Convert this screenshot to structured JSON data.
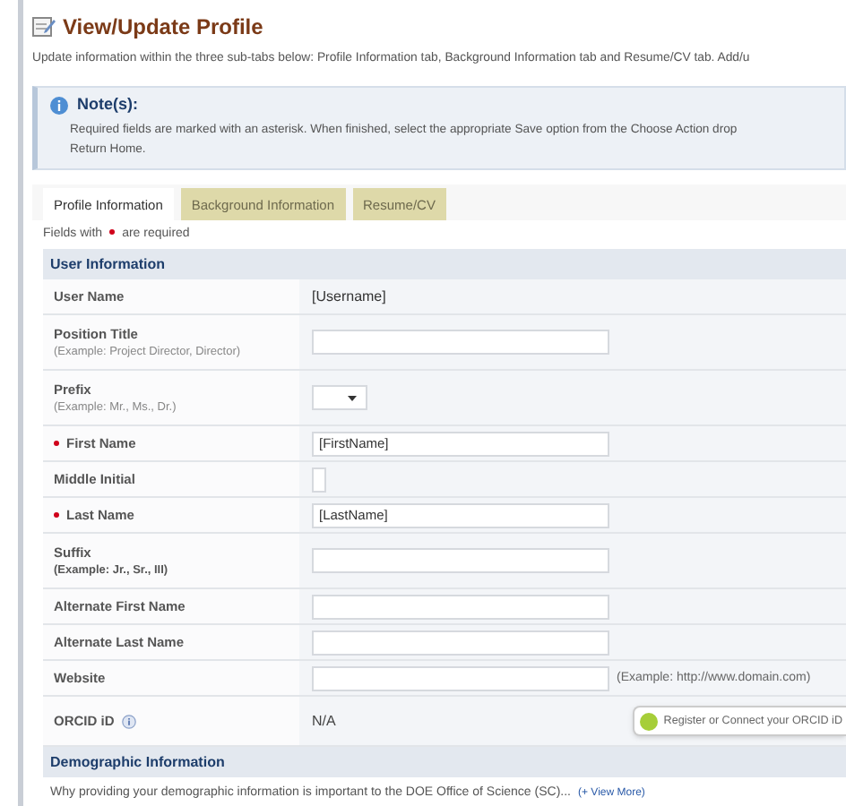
{
  "header": {
    "title": "View/Update Profile",
    "description": "Update information within the three sub-tabs below: Profile Information tab, Background Information tab and Resume/CV tab. Add/u"
  },
  "note": {
    "title": "Note(s):",
    "text": "Required fields are marked with an asterisk. When finished, select the appropriate Save option from the Choose Action drop",
    "text_2": "Return Home."
  },
  "tabs": [
    {
      "label": "Profile Information",
      "selected": true
    },
    {
      "label": "Background Information",
      "selected": false
    },
    {
      "label": "Resume/CV",
      "selected": false
    }
  ],
  "required_hint": {
    "before": "Fields with",
    "after": "are required"
  },
  "user_information": {
    "title": "User Information",
    "rows": [
      {
        "kind": "text",
        "label": "User Name",
        "required": false,
        "value": "[Username]"
      },
      {
        "kind": "input",
        "label": "Position Title",
        "hint": "(Example: Project Director, Director)",
        "required": false
      },
      {
        "kind": "select",
        "label": "Prefix",
        "hint": "(Example: Mr., Ms., Dr.)",
        "required": false
      },
      {
        "kind": "input",
        "label": "First Name",
        "required": true,
        "value": "[FirstName]"
      },
      {
        "kind": "initial",
        "label": "Middle Initial",
        "required": false
      },
      {
        "kind": "input",
        "label": "Last Name",
        "required": true,
        "value": "[LastName]"
      },
      {
        "kind": "input",
        "label": "Suffix",
        "hint": "(Example: Jr., Sr., III)",
        "required": false
      },
      {
        "kind": "input",
        "label": "Alternate First Name",
        "required": false
      },
      {
        "kind": "input",
        "label": "Alternate Last Name",
        "required": false
      },
      {
        "kind": "input",
        "label": "Website",
        "required": false,
        "example": "(Example: http://www.domain.com)"
      },
      {
        "kind": "orcid",
        "label": "ORCID iD",
        "required": false,
        "value": "N/A",
        "button": "Register or Connect your ORCID iD"
      }
    ]
  },
  "demographic_information": {
    "title": "Demographic Information",
    "text": "Why providing your demographic information is important to the DOE Office of Science (SC)...",
    "link": "(+ View More)"
  }
}
